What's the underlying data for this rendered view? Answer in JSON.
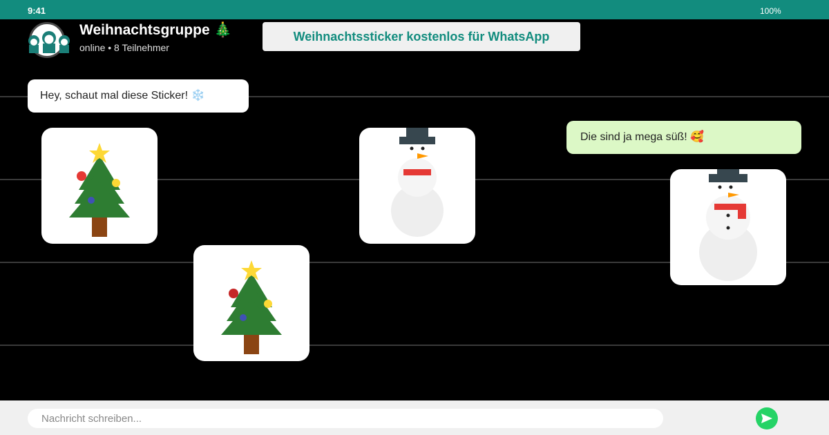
{
  "status_bar": {
    "time": "9:41",
    "battery": "100%"
  },
  "header": {
    "title": "Weihnachtsgruppe 🎄",
    "subtitle": "online • 8 Teilnehmer",
    "promo": "Weihnachtssticker kostenlos für WhatsApp"
  },
  "messages": [
    {
      "direction": "incoming",
      "text": "Hey, schaut mal diese Sticker! ❄️"
    },
    {
      "direction": "outgoing",
      "text": "Die sind ja mega süß! 🥰"
    }
  ],
  "stickers": [
    {
      "sender": "incoming",
      "icon": "christmas-tree-icon"
    },
    {
      "sender": "incoming",
      "icon": "christmas-tree-icon"
    },
    {
      "sender": "incoming",
      "icon": "snowman-icon"
    },
    {
      "sender": "outgoing",
      "icon": "snowman-icon"
    }
  ],
  "composer": {
    "placeholder": "Nachricht schreiben...",
    "send_icon": "send-icon"
  },
  "colors": {
    "header": "#128c7e",
    "incoming_bubble": "#ffffff",
    "outgoing_bubble": "#dcf8c6",
    "send_button": "#25d366",
    "chat_background": "#000000"
  }
}
